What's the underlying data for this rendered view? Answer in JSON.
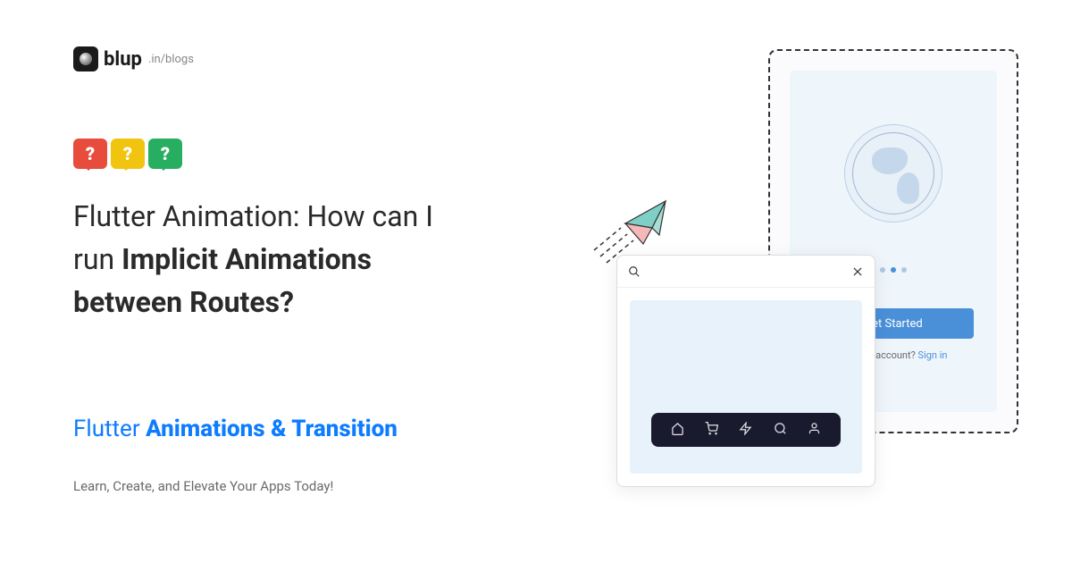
{
  "logo": {
    "name": "blup",
    "suffix": ".in/blogs"
  },
  "bubbles": [
    "?",
    "?",
    "?"
  ],
  "title": {
    "line1_plain": "Flutter Animation: How can I",
    "line2_plain": "run ",
    "line2_bold": "Implicit Animations",
    "line3_bold": "between Routes?"
  },
  "subtitle": {
    "light": "Flutter ",
    "heavy": "Animations & Transition"
  },
  "tagline": "Learn, Create, and Elevate Your Apps Today!",
  "illustration": {
    "phone": {
      "button_label": "Get Started",
      "signin_prefix": "have an account? ",
      "signin_link": "Sign in"
    },
    "colors": {
      "accent": "#0d7cff",
      "button": "#4a90d9",
      "navbar": "#1a1a2e"
    }
  }
}
